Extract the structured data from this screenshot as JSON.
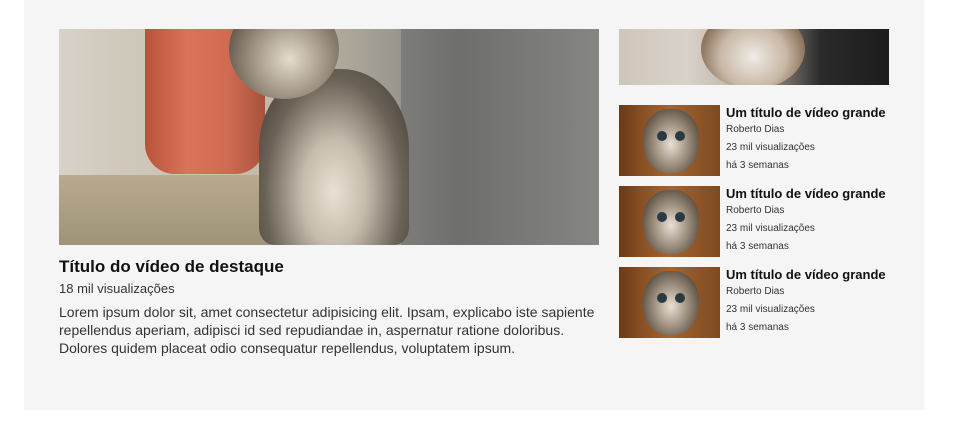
{
  "featured": {
    "title": "Título do vídeo de destaque",
    "views": "18 mil visualizações",
    "description": "Lorem ipsum dolor sit, amet consectetur adipisicing elit. Ipsam, explicabo iste sapiente repellendus aperiam, adipisci id sed repudiandae in, aspernatur ratione doloribus. Dolores quidem placeat odio consequatur repellendus, voluptatem ipsum."
  },
  "videos": [
    {
      "title": "Um título de vídeo grande",
      "author": "Roberto Dias",
      "views": "23 mil visualizações",
      "age": "há 3 semanas"
    },
    {
      "title": "Um título de vídeo grande",
      "author": "Roberto Dias",
      "views": "23 mil visualizações",
      "age": "há 3 semanas"
    },
    {
      "title": "Um título de vídeo grande",
      "author": "Roberto Dias",
      "views": "23 mil visualizações",
      "age": "há 3 semanas"
    }
  ]
}
